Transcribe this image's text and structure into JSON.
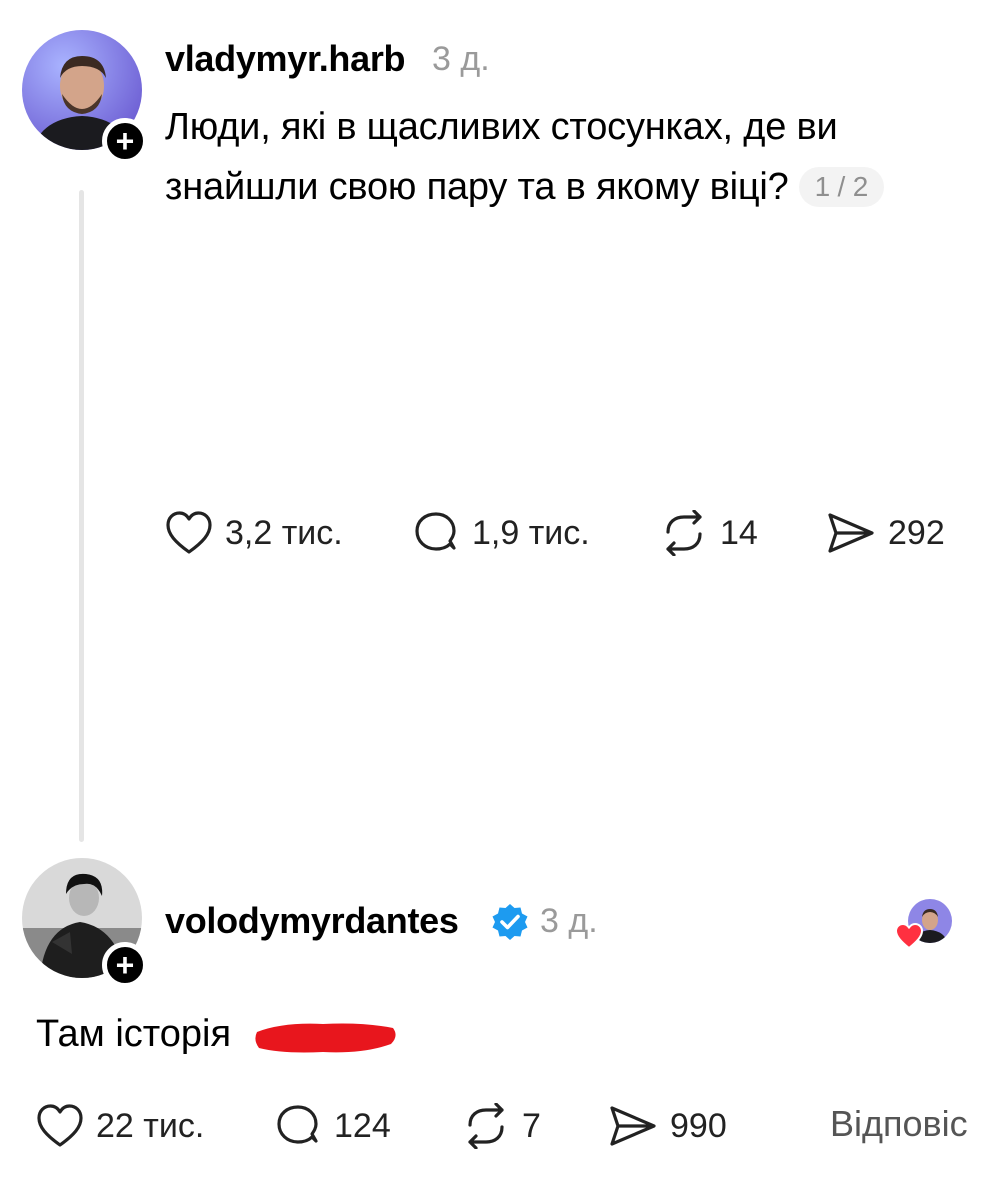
{
  "post": {
    "username": "vladymyr.harb",
    "time": "3 д.",
    "text": "Люди, які в щасливих стосунках, де ви знайшли свою пару та в якому віці?",
    "page_indicator": "1 / 2",
    "avatar_icon": "user-photo",
    "follow_icon": "plus-icon",
    "follow_symbol": "+",
    "actions": {
      "likes": "3,2 тис.",
      "comments": "1,9 тис.",
      "reposts": "14",
      "shares": "292"
    }
  },
  "reply": {
    "username": "volodymyrdantes",
    "verified_icon": "verified-badge-icon",
    "time": "3 д.",
    "text": "Там історія",
    "follow_symbol": "+",
    "liked_by_author_icon": "heart-icon",
    "actions": {
      "likes": "22 тис.",
      "comments": "124",
      "reposts": "7",
      "shares": "990",
      "reply_label": "Відповіс"
    }
  },
  "colors": {
    "accent_verified": "#1d9bf0",
    "redaction": "#e8161d",
    "heart": "#ff3040",
    "muted_text": "#9a9a9a"
  }
}
